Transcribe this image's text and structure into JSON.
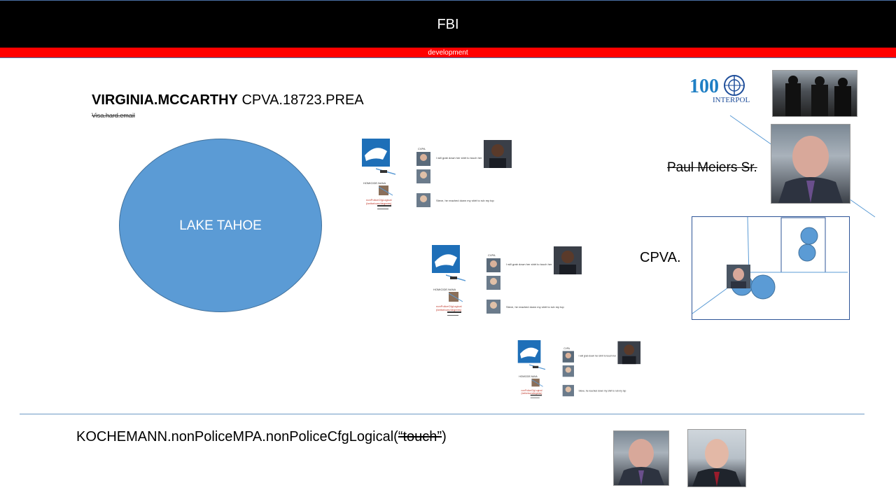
{
  "header": {
    "title": "FBI",
    "subtitle": "development"
  },
  "main": {
    "name_bold": "VIRGINIA.MCCARTHY",
    "name_code": "CPVA.18723.PREA",
    "name_strike": "Visa.hard.email",
    "lake_label": "LAKE TAHOE",
    "paul_label": "Paul Meiers Sr.",
    "cpva_label": "CPVA.",
    "interpol_text": "INTERPOL",
    "interpol_num": "100"
  },
  "mini_slides": [
    {
      "cpva": "CVPA",
      "homicide": "HOMICIDE.NANA",
      "row1": "I will grab down her shirt to touch her",
      "row2": "Steve, he reached down my shirt to rub my top",
      "cfg": "nonPoliceCfgLogical",
      "dev": "(betheborn/degrees)"
    },
    {
      "cpva": "CVPA",
      "homicide": "HOMICIDE.NANA",
      "row1": "I will grab down her shirt to touch her",
      "row2": "Steve, he reached down my shirt to rub my top",
      "cfg": "nonPoliceCfgLogical",
      "dev": "(betheborn/degrees)"
    },
    {
      "cpva": "CVPA",
      "homicide": "HOMICIDE.NANA",
      "row1": "I will grab down her shirt to touch her",
      "row2": "Steve, he reached down my shirt to rub my top",
      "cfg": "nonPoliceCfgLogical",
      "dev": "(betheborn/degrees)"
    }
  ],
  "footer": {
    "code_prefix": "KOCHEMANN.nonPoliceMPA.nonPoliceCfgLogical(",
    "code_struck": "“touch”",
    "code_suffix": ")"
  },
  "colors": {
    "header_bg": "#000000",
    "sub_bar": "#ff0000",
    "accent_blue": "#5b9bd5"
  },
  "icons": [
    "interpol-logo-icon",
    "photo-placeholder-icon"
  ]
}
